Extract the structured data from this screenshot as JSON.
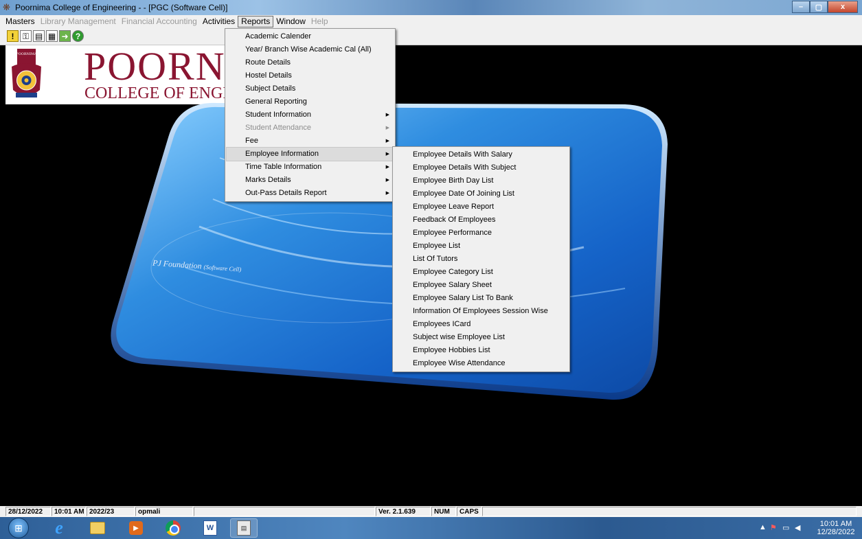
{
  "window": {
    "title": "Poornima College of Engineering -  - [PGC (Software Cell)]",
    "controls": [
      "–",
      "▢",
      "x"
    ]
  },
  "menubar": {
    "items": [
      {
        "label": "Masters",
        "disabled": false
      },
      {
        "label": "Library Management",
        "disabled": true
      },
      {
        "label": "Financial Accounting",
        "disabled": true
      },
      {
        "label": "Activities",
        "disabled": false
      },
      {
        "label": "Reports",
        "disabled": false,
        "active": true
      },
      {
        "label": "Window",
        "disabled": false
      },
      {
        "label": "Help",
        "disabled": true
      }
    ]
  },
  "toolbar": {
    "icons": [
      "warning-icon",
      "key-icon",
      "form-icon",
      "calculator-icon",
      "exit-icon",
      "help-icon"
    ]
  },
  "logo": {
    "title": "POORNI",
    "subtitle": "COLLEGE OF ENGINI",
    "crest_text": "POORNIMA"
  },
  "desktop": {
    "caption": "PJ Foundation",
    "caption_sub": "(Software Cell)"
  },
  "reports_menu": {
    "items": [
      {
        "label": "Academic Calender",
        "submenu": false,
        "disabled": false
      },
      {
        "label": "Year/ Branch Wise Academic Cal (All)",
        "submenu": false,
        "disabled": false
      },
      {
        "label": "Route Details",
        "submenu": false,
        "disabled": false
      },
      {
        "label": "Hostel Details",
        "submenu": false,
        "disabled": false
      },
      {
        "label": "Subject Details",
        "submenu": false,
        "disabled": false
      },
      {
        "label": "General Reporting",
        "submenu": false,
        "disabled": false
      },
      {
        "label": "Student Information",
        "submenu": true,
        "disabled": false
      },
      {
        "label": "Student Attendance",
        "submenu": true,
        "disabled": true
      },
      {
        "label": "Fee",
        "submenu": true,
        "disabled": false
      },
      {
        "label": "Employee Information",
        "submenu": true,
        "disabled": false,
        "highlight": true
      },
      {
        "label": "Time Table Information",
        "submenu": true,
        "disabled": false
      },
      {
        "label": "Marks Details",
        "submenu": true,
        "disabled": false
      },
      {
        "label": "Out-Pass Details Report",
        "submenu": true,
        "disabled": false
      }
    ]
  },
  "employee_menu": {
    "items": [
      "Employee Details With Salary",
      "Employee Details With Subject",
      "Employee Birth Day List",
      "Employee Date Of Joining List",
      "Employee Leave  Report",
      "Feedback Of Employees",
      "Employee Performance",
      "Employee List",
      "List Of Tutors",
      "Employee Category List",
      "Employee Salary Sheet",
      "Employee Salary List To Bank",
      "Information Of Employees Session Wise",
      "Employees ICard",
      "Subject wise Employee List",
      "Employee Hobbies List",
      "Employee Wise Attendance"
    ]
  },
  "statusbar": {
    "date": "28/12/2022",
    "time": "10:01 AM",
    "session": "2022/23",
    "user": "opmali",
    "version": "Ver. 2.1.639",
    "num": "NUM",
    "caps": "CAPS"
  },
  "taskbar": {
    "clock_time": "10:01 AM",
    "clock_date": "12/28/2022",
    "apps": [
      "internet-explorer-icon",
      "file-explorer-icon",
      "media-player-icon",
      "chrome-icon",
      "word-icon",
      "pgc-app-icon"
    ]
  }
}
